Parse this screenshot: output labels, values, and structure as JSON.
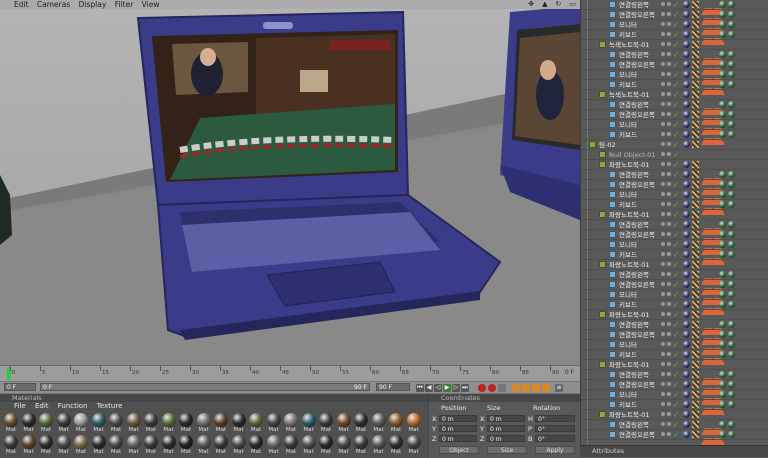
{
  "menu": {
    "edit": "Edit",
    "cameras": "Cameras",
    "display": "Display",
    "filter": "Filter",
    "view": "View"
  },
  "timeline": {
    "ticks": [
      "0",
      "5",
      "10",
      "15",
      "20",
      "25",
      "30",
      "35",
      "40",
      "45",
      "50",
      "55",
      "60",
      "65",
      "70",
      "75",
      "80",
      "85",
      "90"
    ],
    "end_label": "0 F"
  },
  "transport": {
    "current_frame": "0 F",
    "start_frame": "0 F",
    "end_frame": "90 F",
    "max_frame": "90 F"
  },
  "materials": {
    "title": "Materials",
    "menu": {
      "file": "File",
      "edit": "Edit",
      "function": "Function",
      "texture": "Texture"
    },
    "item_label": "Mat",
    "row1_colors": [
      "#6b4a2a",
      "#2c2c2c",
      "#556d3a",
      "#3d3d3d",
      "#9a9a9a",
      "#2f5d6b",
      "#4b4b4b",
      "#6d5a3b",
      "#3c3c3c",
      "#556d3a",
      "#2a2a2a",
      "#717171",
      "#5b3f28",
      "#2c2c2c",
      "#5a6b3a",
      "#444444",
      "#7a7a7a",
      "#2f5d6b",
      "#3c3c3c",
      "#6b4a2a",
      "#2d2d2d",
      "#5c5c5c",
      "#8a5a2a",
      "#b86a2a"
    ],
    "row2_colors": [
      "#3a3a3a",
      "#5b3f28",
      "#2c2c2c",
      "#4a4a4a",
      "#7a6a4a",
      "#2a2a2a",
      "#4b4b4b",
      "#656565",
      "#3c3c3c",
      "#2c2c2c",
      "#1e1e1e",
      "#5a5a5a",
      "#3a3a3a",
      "#4a4a4a",
      "#2a2a2a",
      "#6a6a6a",
      "#3c3c3c",
      "#505050",
      "#2a2a2a",
      "#474747",
      "#3a3a3a",
      "#5a5a5a",
      "#303030",
      "#474747"
    ]
  },
  "coordinates": {
    "title": "Coordinates",
    "headers": {
      "position": "Position",
      "size": "Size",
      "rotation": "Rotation"
    },
    "axes": [
      {
        "pos_axis": "X",
        "pos": "0 m",
        "size_axis": "X",
        "size": "0 m",
        "rot_axis": "H",
        "rot": "0°"
      },
      {
        "pos_axis": "Y",
        "pos": "0 m",
        "size_axis": "Y",
        "size": "0 m",
        "rot_axis": "P",
        "rot": "0°"
      },
      {
        "pos_axis": "Z",
        "pos": "0 m",
        "size_axis": "Z",
        "size": "0 m",
        "rot_axis": "B",
        "rot": "0°"
      }
    ],
    "object_dropdown": "Object",
    "size_dropdown": "Size",
    "apply": "Apply"
  },
  "objects": [
    {
      "name": "연결링왼쪽",
      "indent": 2,
      "kind": "part"
    },
    {
      "name": "연결링오른쪽",
      "indent": 2,
      "kind": "part"
    },
    {
      "name": "모니터",
      "indent": 2,
      "kind": "part"
    },
    {
      "name": "키보드",
      "indent": 2,
      "kind": "part"
    },
    {
      "name": "녹색노트북-01",
      "indent": 1,
      "kind": "group"
    },
    {
      "name": "연결링왼쪽",
      "indent": 2,
      "kind": "part"
    },
    {
      "name": "연결링오른쪽",
      "indent": 2,
      "kind": "part"
    },
    {
      "name": "모니터",
      "indent": 2,
      "kind": "part"
    },
    {
      "name": "키보드",
      "indent": 2,
      "kind": "part"
    },
    {
      "name": "녹색노트북-01",
      "indent": 1,
      "kind": "group"
    },
    {
      "name": "연결링왼쪽",
      "indent": 2,
      "kind": "part"
    },
    {
      "name": "연결링오른쪽",
      "indent": 2,
      "kind": "part"
    },
    {
      "name": "모니터",
      "indent": 2,
      "kind": "part"
    },
    {
      "name": "키보드",
      "indent": 2,
      "kind": "part"
    },
    {
      "name": "팀-02",
      "indent": 0,
      "kind": "group"
    },
    {
      "name": "Null Object-01",
      "indent": 1,
      "kind": "null"
    },
    {
      "name": "파랑노트북-01",
      "indent": 1,
      "kind": "group"
    },
    {
      "name": "연결링왼쪽",
      "indent": 2,
      "kind": "part"
    },
    {
      "name": "연결링오른쪽",
      "indent": 2,
      "kind": "part"
    },
    {
      "name": "모니터",
      "indent": 2,
      "kind": "part"
    },
    {
      "name": "키보드",
      "indent": 2,
      "kind": "part"
    },
    {
      "name": "파랑노트북-01",
      "indent": 1,
      "kind": "group"
    },
    {
      "name": "연결링왼쪽",
      "indent": 2,
      "kind": "part"
    },
    {
      "name": "연결링오른쪽",
      "indent": 2,
      "kind": "part"
    },
    {
      "name": "모니터",
      "indent": 2,
      "kind": "part"
    },
    {
      "name": "키보드",
      "indent": 2,
      "kind": "part"
    },
    {
      "name": "파랑노트북-01",
      "indent": 1,
      "kind": "group"
    },
    {
      "name": "연결링왼쪽",
      "indent": 2,
      "kind": "part"
    },
    {
      "name": "연결링오른쪽",
      "indent": 2,
      "kind": "part"
    },
    {
      "name": "모니터",
      "indent": 2,
      "kind": "part"
    },
    {
      "name": "키보드",
      "indent": 2,
      "kind": "part"
    },
    {
      "name": "파랑노트북-01",
      "indent": 1,
      "kind": "group"
    },
    {
      "name": "연결링왼쪽",
      "indent": 2,
      "kind": "part"
    },
    {
      "name": "연결링오른쪽",
      "indent": 2,
      "kind": "part"
    },
    {
      "name": "모니터",
      "indent": 2,
      "kind": "part"
    },
    {
      "name": "키보드",
      "indent": 2,
      "kind": "part"
    },
    {
      "name": "파랑노트북-01",
      "indent": 1,
      "kind": "group"
    },
    {
      "name": "연결링왼쪽",
      "indent": 2,
      "kind": "part"
    },
    {
      "name": "연결링오른쪽",
      "indent": 2,
      "kind": "part"
    },
    {
      "name": "모니터",
      "indent": 2,
      "kind": "part"
    },
    {
      "name": "키보드",
      "indent": 2,
      "kind": "part"
    },
    {
      "name": "파랑노트북-01",
      "indent": 1,
      "kind": "group"
    },
    {
      "name": "연결링왼쪽",
      "indent": 2,
      "kind": "part"
    },
    {
      "name": "연결링오른쪽",
      "indent": 2,
      "kind": "part"
    }
  ],
  "attributes": {
    "label": "Attributes"
  },
  "colors": {
    "laptop_body": "#3a3c8a",
    "laptop_dark": "#25265c",
    "keyboard": "#5b5fa6",
    "screen_stage": "#3a2a20"
  }
}
